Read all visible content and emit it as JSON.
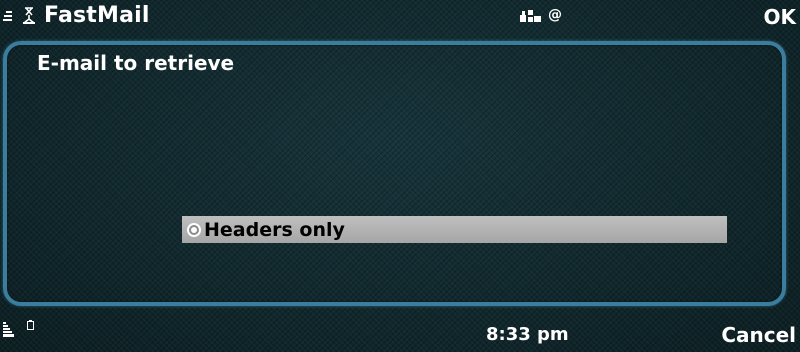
{
  "status_bar": {
    "app_title": "FastMail",
    "email_indicator": "@",
    "left_softkey": "OK"
  },
  "dialog": {
    "title": "E-mail to retrieve",
    "selected_option": "Headers only"
  },
  "bottom_bar": {
    "time": "8:33 pm",
    "right_softkey": "Cancel"
  },
  "colors": {
    "frame_border": "#3b7d9c",
    "selection_background": "#b3b3b3",
    "background": "#10262b"
  }
}
